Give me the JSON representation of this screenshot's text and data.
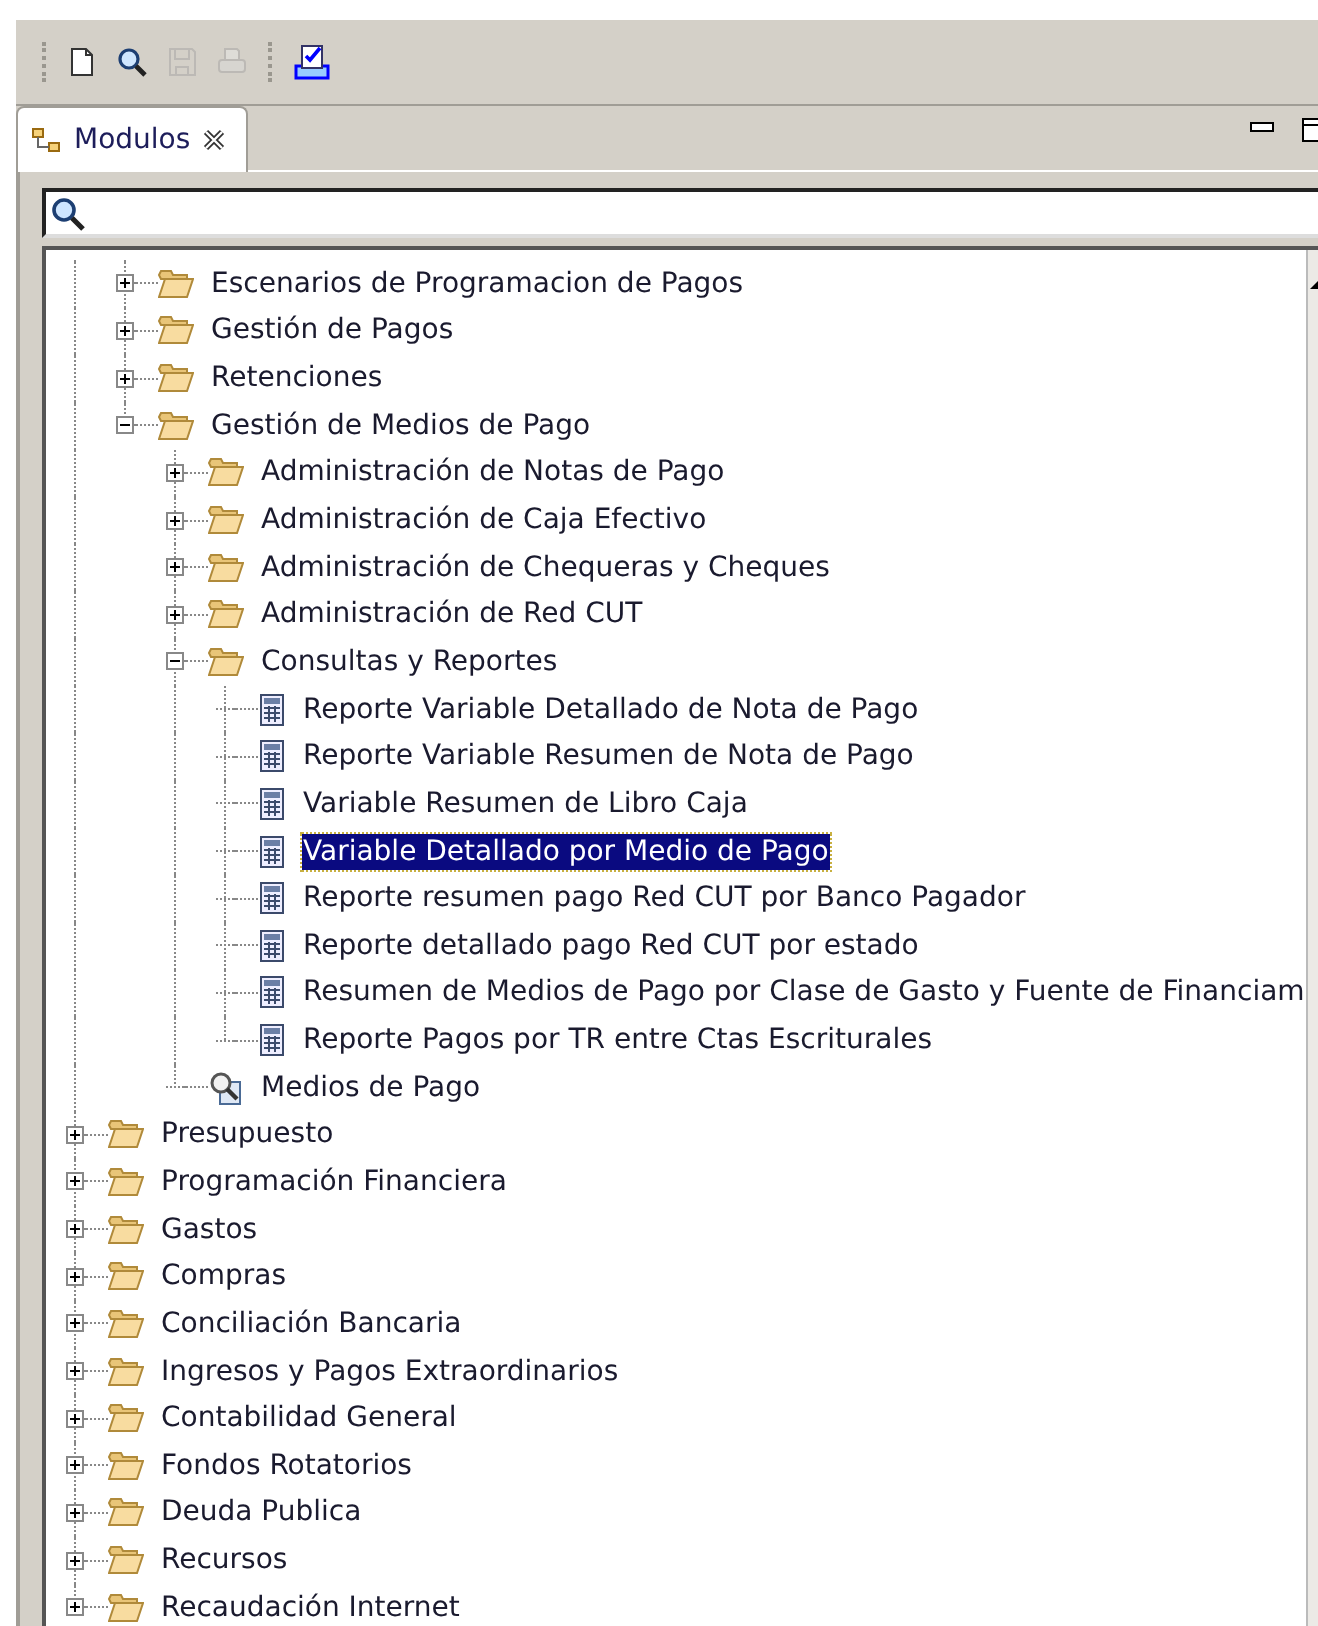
{
  "toolbar": {
    "buttons": [
      {
        "kind": "new",
        "disabled": false
      },
      {
        "kind": "search",
        "disabled": false
      },
      {
        "kind": "save",
        "disabled": true
      },
      {
        "kind": "print",
        "disabled": true
      },
      {
        "kind": "separator"
      },
      {
        "kind": "checklist",
        "disabled": false
      }
    ]
  },
  "tabs": [
    {
      "label": "Modulos",
      "selected": true
    }
  ],
  "tree": {
    "items": [
      {
        "children": [
          {
            "kind": "folder",
            "label": "Escenarios de Programacion de Pagos",
            "expanded": false,
            "selected": false
          },
          {
            "kind": "folder",
            "label": "Gestión de Pagos",
            "expanded": false,
            "selected": false
          },
          {
            "kind": "folder",
            "label": "Retenciones",
            "expanded": false,
            "selected": false
          },
          {
            "kind": "folder",
            "label": "Gestión de Medios de Pago",
            "expanded": true,
            "selected": false,
            "children": [
              {
                "kind": "folder",
                "label": "Administración de Notas de Pago",
                "expanded": false,
                "selected": false
              },
              {
                "kind": "folder",
                "label": "Administración de Caja Efectivo",
                "expanded": false,
                "selected": false
              },
              {
                "kind": "folder",
                "label": "Administración de Chequeras y Cheques",
                "expanded": false,
                "selected": false
              },
              {
                "kind": "folder",
                "label": "Administración de Red CUT",
                "expanded": false,
                "selected": false
              },
              {
                "kind": "folder",
                "label": "Consultas y Reportes",
                "expanded": true,
                "selected": false,
                "children": [
                  {
                    "kind": "report",
                    "label": "Reporte Variable Detallado de Nota de Pago",
                    "selected": false
                  },
                  {
                    "kind": "report",
                    "label": "Reporte Variable Resumen de Nota de Pago",
                    "selected": false
                  },
                  {
                    "kind": "report",
                    "label": "Variable Resumen de Libro Caja",
                    "selected": false
                  },
                  {
                    "kind": "report",
                    "label": "Variable Detallado por Medio de Pago",
                    "selected": true
                  },
                  {
                    "kind": "report",
                    "label": "Reporte resumen pago Red CUT por Banco Pagador",
                    "selected": false
                  },
                  {
                    "kind": "report",
                    "label": "Reporte detallado pago Red CUT por estado",
                    "selected": false
                  },
                  {
                    "kind": "report",
                    "label": "Resumen de Medios de Pago por Clase de Gasto y Fuente de Financiam",
                    "selected": false
                  },
                  {
                    "kind": "report",
                    "label": "Reporte Pagos por TR entre Ctas Escriturales",
                    "selected": false
                  }
                ]
              },
              {
                "kind": "query",
                "label": "Medios de Pago",
                "selected": false
              }
            ]
          }
        ]
      },
      {
        "kind": "folder",
        "label": "Presupuesto",
        "expanded": false,
        "selected": false
      },
      {
        "kind": "folder",
        "label": "Programación Financiera",
        "expanded": false,
        "selected": false
      },
      {
        "kind": "folder",
        "label": "Gastos",
        "expanded": false,
        "selected": false
      },
      {
        "kind": "folder",
        "label": "Compras",
        "expanded": false,
        "selected": false
      },
      {
        "kind": "folder",
        "label": "Conciliación Bancaria",
        "expanded": false,
        "selected": false
      },
      {
        "kind": "folder",
        "label": "Ingresos y Pagos Extraordinarios",
        "expanded": false,
        "selected": false
      },
      {
        "kind": "folder",
        "label": "Contabilidad General",
        "expanded": false,
        "selected": false
      },
      {
        "kind": "folder",
        "label": "Fondos Rotatorios",
        "expanded": false,
        "selected": false
      },
      {
        "kind": "folder",
        "label": "Deuda Publica",
        "expanded": false,
        "selected": false
      },
      {
        "kind": "folder",
        "label": "Recursos",
        "expanded": false,
        "selected": false
      },
      {
        "kind": "folder",
        "label": "Recaudación Internet",
        "expanded": false,
        "selected": false
      }
    ]
  }
}
